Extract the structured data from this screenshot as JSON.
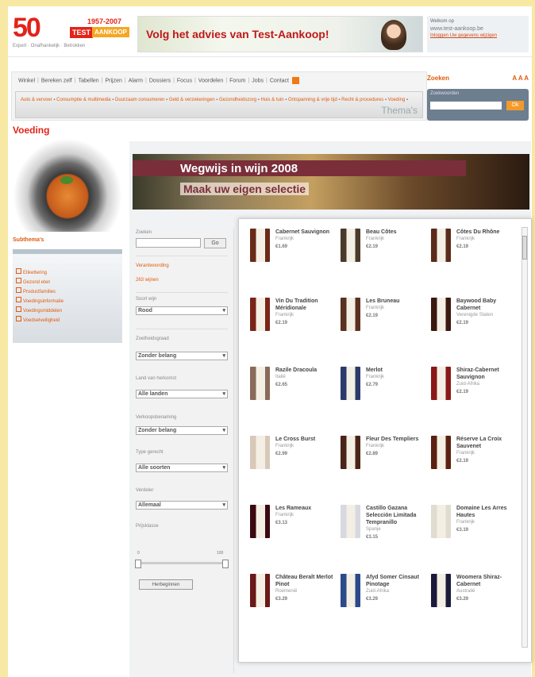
{
  "logo": {
    "number": "50",
    "years": "1957-2007",
    "test": "TEST",
    "aankoop": "AANKOOP",
    "tagline": "Expert · Onafhankelijk · Betrokken"
  },
  "banner": {
    "text": "Volg het advies van Test-Aankoop!"
  },
  "topright": {
    "line1": "Welkom op",
    "line2": "www.test-aankoop.be",
    "line3": "Inloggen  Uw gegevens wijzigen"
  },
  "nav": {
    "items": [
      "Winkel",
      "Bereken zelf",
      "Tabellen",
      "Prijzen",
      "Alarm",
      "Dossiers",
      "Focus",
      "Voordelen",
      "Forum",
      "Jobs",
      "Contact"
    ],
    "themas_label": "Thema's",
    "subitems": [
      "Auto & vervoer",
      "Consumptie & multimedia",
      "Duurzaam consumeren",
      "Geld & verzekeringen",
      "Gezondheidszorg",
      "Huis & tuin",
      "Ontspanning & vrije tijd",
      "Recht & procedures",
      "Voeding"
    ]
  },
  "zoeken": {
    "title": "Zoeken",
    "aaa": "A A A",
    "label": "Zoekwoorden",
    "go": "Ok"
  },
  "section": {
    "title": "Voeding",
    "subthemas": "Subthema's",
    "items": [
      "Etikettering",
      "Gezond eten",
      "Productfamilies",
      "Voedingsinformatie",
      "Voedingsmiddelen",
      "Voedselveiligheid"
    ]
  },
  "hero": {
    "title": "Wegwijs in wijn 2008",
    "subtitle": "Maak uw eigen selectie"
  },
  "filters": {
    "search_label": "Zoeken",
    "go": "Go",
    "link1": "Verantwoording",
    "link2": "263 wijnen",
    "soort_label": "Soort wijn",
    "soort_value": "Rood",
    "zoetheid_label": "Zoetheidsgraad",
    "zoetheid_value": "Zonder belang",
    "land_label": "Land van herkomst",
    "land_value": "Alle landen",
    "verkoop_label": "Verkoopsbenaming",
    "verkoop_value": "Zonder belang",
    "type_label": "Type gerecht",
    "type_value": "Alle soorten",
    "verdeler_label": "Verdeler",
    "verdeler_value": "Allemaal",
    "prijs_label": "Prijsklasse",
    "prijs_min": "0",
    "prijs_max": "100",
    "reset": "Herbeginnen"
  },
  "wines": [
    {
      "name": "Cabernet Sauvignon",
      "country": "Frankrijk",
      "price": "€1.69",
      "color": "#6a2a18"
    },
    {
      "name": "Beau Côtes",
      "country": "Frankrijk",
      "price": "€2.19",
      "color": "#4a3a2a"
    },
    {
      "name": "Côtes Du Rhône",
      "country": "Frankrijk",
      "price": "€2.19",
      "color": "#5a2a1a"
    },
    {
      "name": "Vin Du Tradition Méridionale",
      "country": "Frankrijk",
      "price": "€2.19",
      "color": "#7a2418"
    },
    {
      "name": "Les Bruneau",
      "country": "Frankrijk",
      "price": "€2.19",
      "color": "#5a3020"
    },
    {
      "name": "Baywood Baby Cabernet",
      "country": "Verenigde Staten",
      "price": "€2.19",
      "color": "#3a1810"
    },
    {
      "name": "Razile Dracoula",
      "country": "Italië",
      "price": "€2.65",
      "color": "#8a6a5a"
    },
    {
      "name": "Merlot",
      "country": "Frankrijk",
      "price": "€2.79",
      "color": "#2a3a6a"
    },
    {
      "name": "Shiraz-Cabernet Sauvignon",
      "country": "Zuid-Afrika",
      "price": "€2.19",
      "color": "#8a1818"
    },
    {
      "name": "Le Cross Burst",
      "country": "Frankrijk",
      "price": "€2.99",
      "color": "#d8c8b8"
    },
    {
      "name": "Fleur Des Templiers",
      "country": "Frankrijk",
      "price": "€2.89",
      "color": "#4a2418"
    },
    {
      "name": "Réserve La Croix Sauvenet",
      "country": "Frankrijk",
      "price": "€2.19",
      "color": "#5a2010"
    },
    {
      "name": "Les Rameaux",
      "country": "Frankrijk",
      "price": "€3.13",
      "color": "#3a0a10"
    },
    {
      "name": "Castillo Gazana Selección Limitada Tempranillo",
      "country": "Spanje",
      "price": "€3.15",
      "color": "#d8d8e0"
    },
    {
      "name": "Domaine Les Arres Hautes",
      "country": "Frankrijk",
      "price": "€3.19",
      "color": "#e0dcd0"
    },
    {
      "name": "Château Beralt Merlot Pinot",
      "country": "Roemenië",
      "price": "€3.29",
      "color": "#6a1818"
    },
    {
      "name": "Afyd Somer Cinsaut Pinotage",
      "country": "Zuid-Afrika",
      "price": "€3.29",
      "color": "#2a4a8a"
    },
    {
      "name": "Woomera Shiraz-Cabernet",
      "country": "Australië",
      "price": "€3.29",
      "color": "#1a1a3a"
    }
  ]
}
